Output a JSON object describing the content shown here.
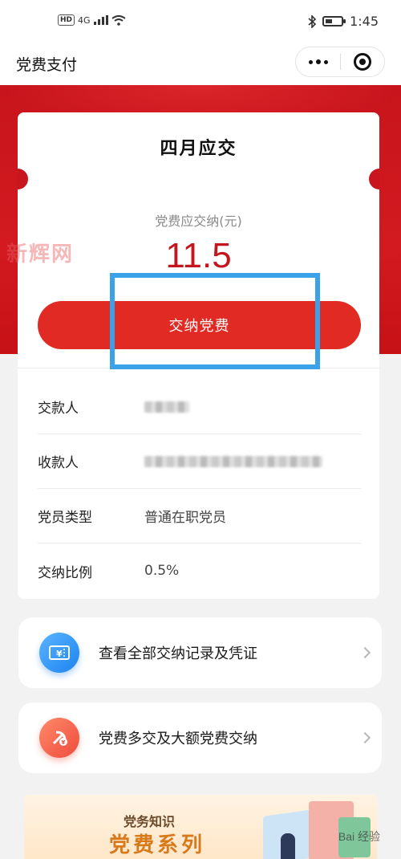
{
  "status_bar": {
    "left_badge": "HD",
    "network": "4G",
    "time": "1:45",
    "icons": [
      "signal-icon",
      "wifi-icon",
      "bluetooth-icon",
      "battery-icon"
    ],
    "battery_level": 0.45
  },
  "nav": {
    "title": "党费支付",
    "more_icon": "more-dots-icon",
    "close_icon": "target-close-icon"
  },
  "card": {
    "title": "四月应交",
    "amount_label": "党费应交纳(元)",
    "amount": "11.5",
    "pay_button_label": "交纳党费",
    "rows": [
      {
        "label": "交款人",
        "value": ""
      },
      {
        "label": "收款人",
        "value": ""
      },
      {
        "label": "党员类型",
        "value": "普通在职党员"
      },
      {
        "label": "交纳比例",
        "value": "0.5%"
      }
    ]
  },
  "actions": [
    {
      "label": "查看全部交纳记录及凭证",
      "icon": "receipt-icon"
    },
    {
      "label": "党费多交及大额党费交纳",
      "icon": "party-emblem-icon"
    }
  ],
  "promo": {
    "subtitle": "党务知识",
    "title": "党费系列"
  },
  "watermarks": {
    "left": "新辉网",
    "bottom_right": "Bai 经验"
  },
  "colors": {
    "banner_red": "#c8141c",
    "button_red": "#e02a23",
    "amount_red": "#c4161c",
    "highlight_blue": "#3aa2e8"
  }
}
